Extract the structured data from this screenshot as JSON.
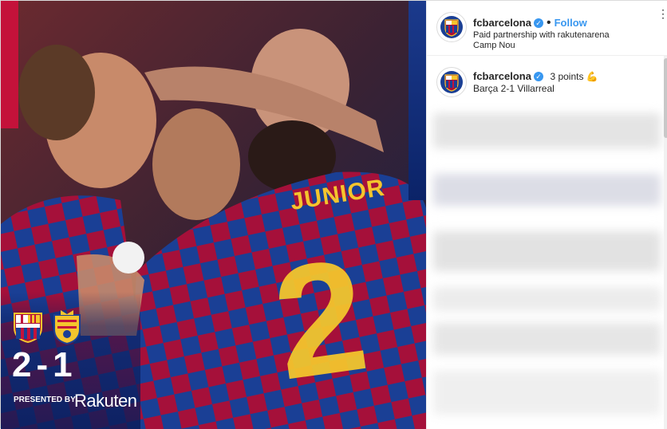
{
  "post": {
    "media": {
      "jersey_name": "JUNIOR",
      "jersey_number": "2",
      "score": "2-1",
      "presented_by": "PRESENTED BY",
      "sponsor": "Rakuten"
    },
    "header": {
      "username": "fcbarcelona",
      "verified_mark": "✓",
      "separator": "•",
      "follow_label": "Follow",
      "partnership_text": "Paid partnership with rakutenarena",
      "location": "Camp Nou",
      "more_icon": "⋮"
    },
    "caption": {
      "username": "fcbarcelona",
      "headline": "3 points 💪",
      "body": "Barça 2-1 Villarreal"
    },
    "colors": {
      "barca_blue": "#1a3f95",
      "barca_red": "#c4123a",
      "gold": "#f4c52d",
      "link_blue": "#3897f0"
    }
  }
}
